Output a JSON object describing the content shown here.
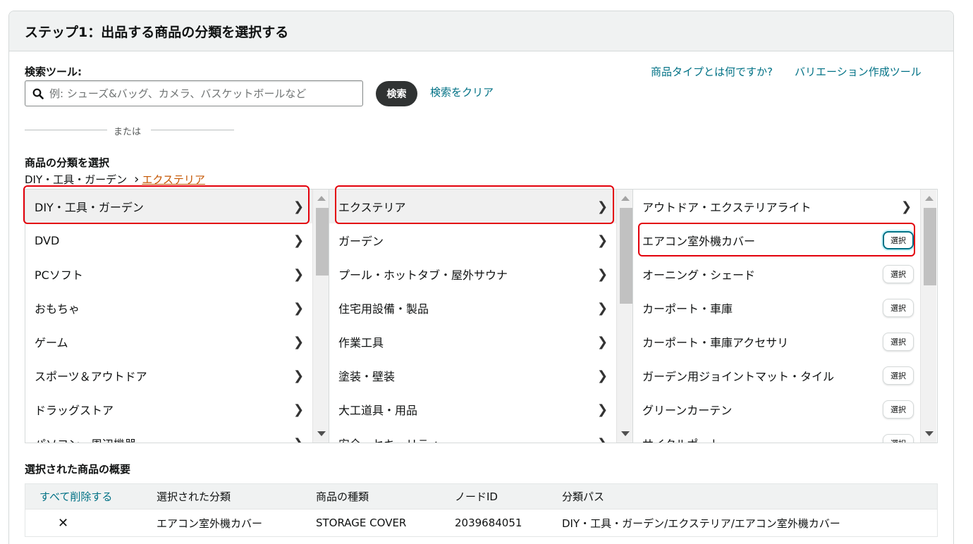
{
  "header": {
    "title": "ステップ1：出品する商品の分類を選択する"
  },
  "search": {
    "label": "検索ツール:",
    "placeholder": "例: シューズ&バッグ、カメラ、バスケットボールなど",
    "button": "検索",
    "clear_link": "検索をクリア"
  },
  "top_links": {
    "what_is_type": "商品タイプとは何ですか?",
    "variation_tool": "バリエーション作成ツール"
  },
  "or_text": "または",
  "category": {
    "label": "商品の分類を選択",
    "breadcrumb": {
      "root": "DIY・工具・ガーデン",
      "sep": "›",
      "current": "エクステリア"
    }
  },
  "columns": {
    "col1": [
      "DIY・工具・ガーデン",
      "DVD",
      "PCソフト",
      "おもちゃ",
      "ゲーム",
      "スポーツ＆アウトドア",
      "ドラッグストア",
      "パソコン・周辺機器"
    ],
    "col2": [
      "エクステリア",
      "ガーデン",
      "プール・ホットタブ・屋外サウナ",
      "住宅用設備・製品",
      "作業工具",
      "塗装・壁装",
      "大工道具・用品",
      "安全・セキュリティ"
    ],
    "col3": [
      "アウトドア・エクステリアライト",
      "エアコン室外機カバー",
      "オーニング・シェード",
      "カーポート・車庫",
      "カーポート・車庫アクセサリ",
      "ガーデン用ジョイントマット・タイル",
      "グリーンカーテン",
      "サイクルポート"
    ],
    "select_label": "選択"
  },
  "summary": {
    "title": "選択された商品の概要",
    "headers": {
      "delete_all": "すべて削除する",
      "selected": "選択された分類",
      "type": "商品の種類",
      "node": "ノードID",
      "path": "分類パス"
    },
    "row": {
      "remove": "✕",
      "selected": "エアコン室外機カバー",
      "type": "STORAGE COVER",
      "node": "2039684051",
      "path": "DIY・工具・ガーデン/エクステリア/エアコン室外機カバー"
    }
  },
  "colors": {
    "link": "#007185",
    "breadcrumb_current": "#c45500",
    "highlight": "#e3000b",
    "button_dark": "#303333"
  }
}
